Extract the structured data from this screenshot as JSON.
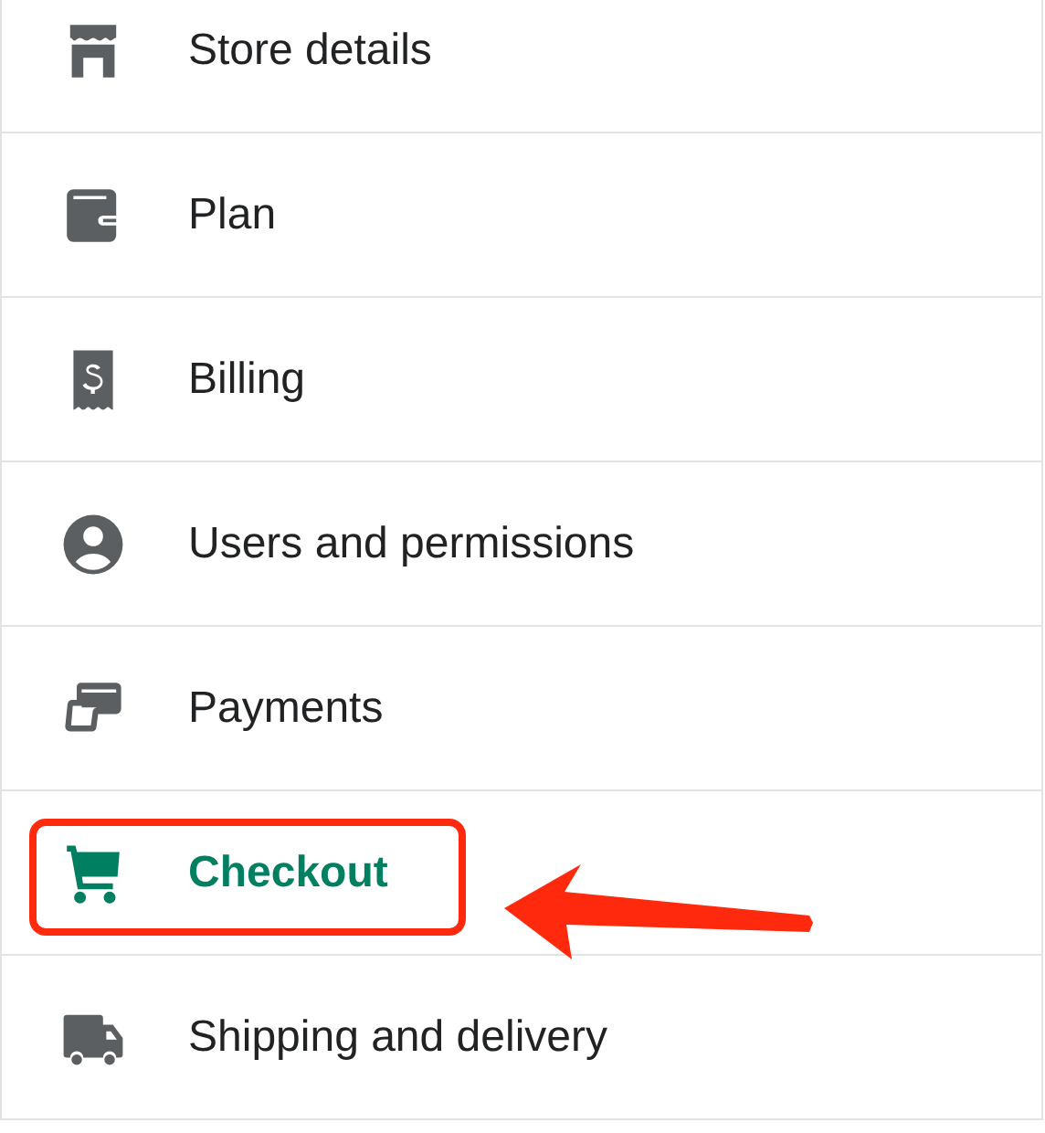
{
  "settings_nav": {
    "items": [
      {
        "label": "Store details",
        "selected": false,
        "highlighted": false
      },
      {
        "label": "Plan",
        "selected": false,
        "highlighted": false
      },
      {
        "label": "Billing",
        "selected": false,
        "highlighted": false
      },
      {
        "label": "Users and permissions",
        "selected": false,
        "highlighted": false
      },
      {
        "label": "Payments",
        "selected": false,
        "highlighted": false
      },
      {
        "label": "Checkout",
        "selected": true,
        "highlighted": true
      },
      {
        "label": "Shipping and delivery",
        "selected": false,
        "highlighted": false
      }
    ]
  }
}
